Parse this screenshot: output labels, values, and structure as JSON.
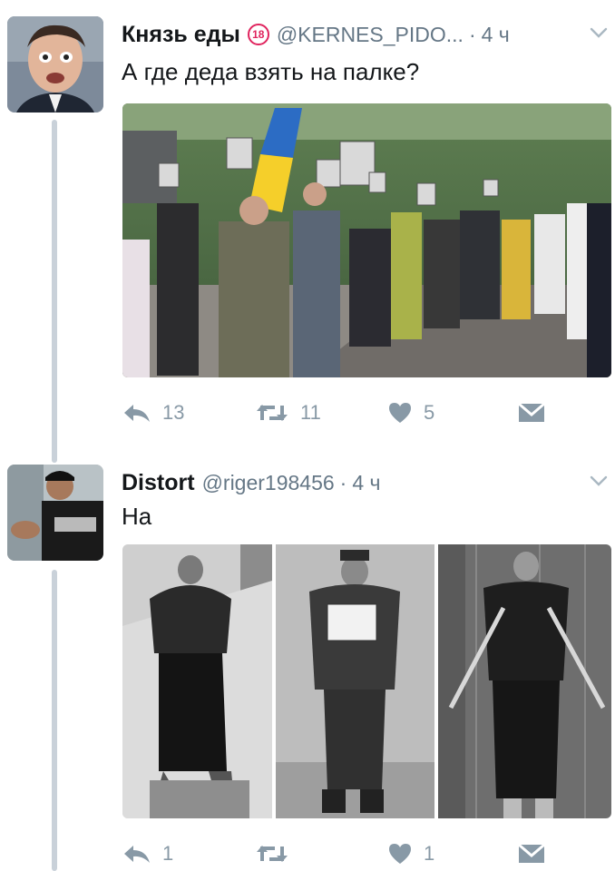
{
  "tweets": [
    {
      "author_name": "Князь еды",
      "age_badge": "18",
      "handle": "@KERNES_PIDO...",
      "separator": "·",
      "time": "4 ч",
      "text": "А где деда взять на палке?",
      "replies": "13",
      "retweets": "11",
      "likes": "5"
    },
    {
      "author_name": "Distort",
      "handle": "@riger198456",
      "separator": "·",
      "time": "4 ч",
      "text": "На",
      "replies": "1",
      "retweets": "",
      "likes": "1"
    }
  ],
  "icons": {
    "reply": "reply-arrow-icon",
    "retweet": "retweet-icon",
    "like": "heart-icon",
    "dm": "envelope-icon",
    "menu": "chevron-down-icon",
    "badge": "age-18-badge-icon"
  },
  "colors": {
    "action_gray": "#8899a6",
    "thread_line": "#c9d1d9",
    "badge_red": "#e0245e",
    "secondary_text": "#657786"
  }
}
